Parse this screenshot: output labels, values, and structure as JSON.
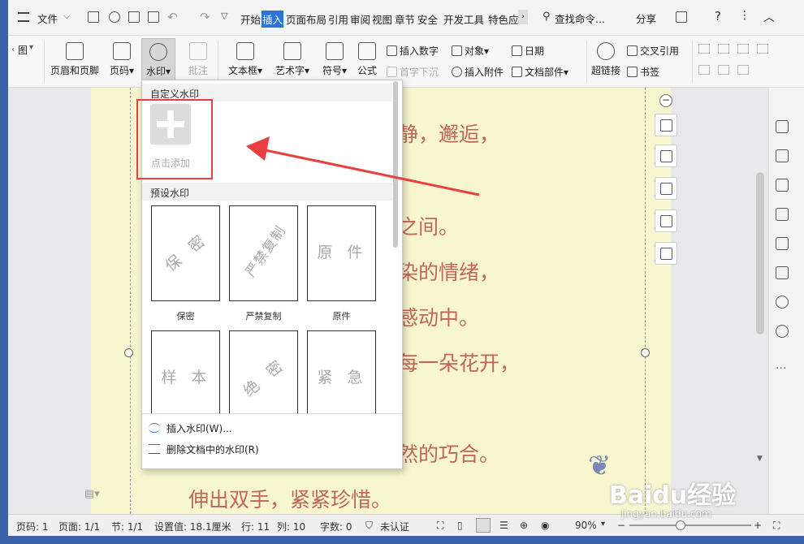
{
  "menubar": {
    "file_label": "文件",
    "tabs": [
      {
        "label": "开始",
        "active": false
      },
      {
        "label": "插入",
        "active": true
      },
      {
        "label": "页面布局",
        "active": false
      },
      {
        "label": "引用",
        "active": false
      },
      {
        "label": "审阅",
        "active": false
      },
      {
        "label": "视图",
        "active": false
      },
      {
        "label": "章节",
        "active": false
      },
      {
        "label": "安全",
        "active": false
      },
      {
        "label": "开发工具",
        "active": false
      },
      {
        "label": "特色应",
        "active": false
      }
    ],
    "search_label": "查找命令...",
    "share_label": "分享"
  },
  "ribbon": {
    "header_footer": "页眉和页脚",
    "page_number": "页码",
    "watermark": "水印",
    "comment": "批注",
    "textbox": "文本框",
    "wordart": "艺术字",
    "symbol": "符号",
    "formula": "公式",
    "insert_number": "插入数字",
    "object": "对象",
    "date": "日期",
    "dropcap": "首字下沉",
    "attachment": "插入附件",
    "doc_parts": "文档部件",
    "hyperlink": "超链接",
    "crossref": "交叉引用",
    "bookmark": "书签"
  },
  "dropdown": {
    "custom_section": "自定义水印",
    "add_label": "点击添加",
    "preset_section": "预设水印",
    "presets": [
      {
        "text": "保 密",
        "label": "保密"
      },
      {
        "text": "严禁复制",
        "label": "严禁复制"
      },
      {
        "text": "原 件",
        "label": "原件"
      },
      {
        "text": "样 本",
        "label": "样本"
      },
      {
        "text": "绝 密",
        "label": "绝密"
      },
      {
        "text": "紧 急",
        "label": "紧急"
      }
    ],
    "insert_action": "插入水印(W)...",
    "delete_action": "删除文档中的水印(R)"
  },
  "document": {
    "lines": [
      "静，邂逅，",
      "之间。",
      "染的情绪，",
      "感动中。",
      "每一朵花开，",
      "然的巧合。",
      "伸出双手，紧紧珍惜。"
    ]
  },
  "statusbar": {
    "page_code": "页码: 1",
    "page": "页面: 1/1",
    "section": "节: 1/1",
    "setting": "设置值: 18.1厘米",
    "row": "行: 11",
    "col": "列: 10",
    "words": "字数: 0",
    "auth": "未认证",
    "zoom": "90%"
  },
  "watermark_overlay": {
    "brand": "Baidu经验",
    "url": "jingyan.baidu.com"
  },
  "colors": {
    "accent": "#2b73d8",
    "annotation": "#e84040",
    "page_bg": "#f7f6cf",
    "text": "#c0665a"
  }
}
